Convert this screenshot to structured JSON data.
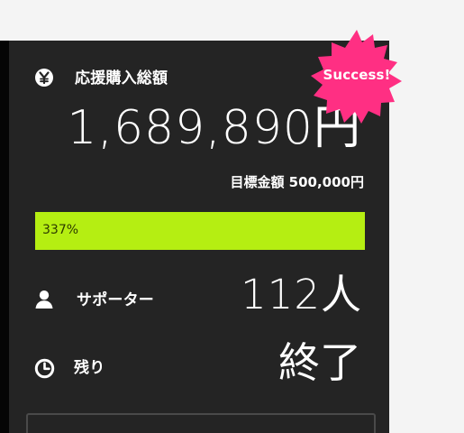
{
  "funding": {
    "total_label": "応援購入総額",
    "total_amount": "1,689,890円",
    "target_text": "目標金額 500,000円",
    "progress": {
      "percent_text": "337%",
      "fill_fraction": 1
    },
    "badge_text": "Success!"
  },
  "supporters": {
    "label": "サポーター",
    "value": "112人"
  },
  "remaining": {
    "label": "残り",
    "value": "終了"
  },
  "icons": {
    "total": "yen-icon",
    "supporters": "person-icon",
    "remaining": "clock-icon",
    "badge": "burst-badge-icon"
  },
  "colors": {
    "panel": "#242424",
    "progress": "#b5ee12",
    "badge": "#ff2f83",
    "text": "#ffffff"
  }
}
